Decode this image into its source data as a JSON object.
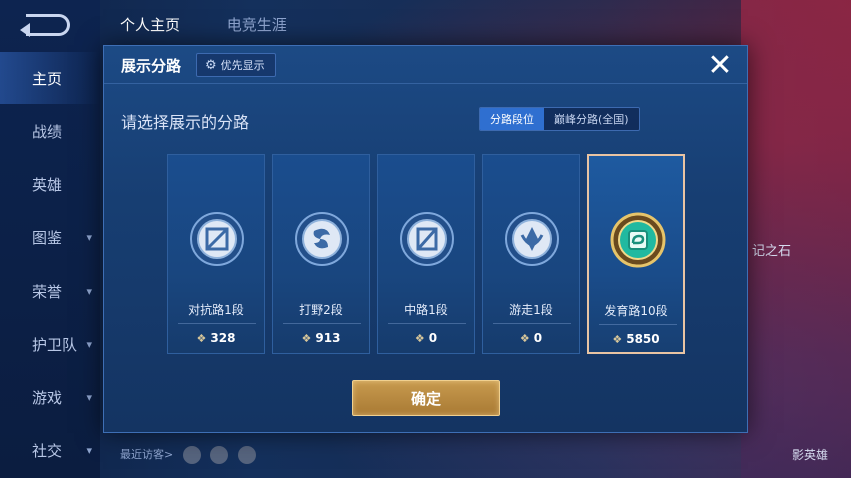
{
  "background": {
    "nav_items": [
      {
        "label": "主页",
        "active": true
      },
      {
        "label": "战绩"
      },
      {
        "label": "英雄"
      },
      {
        "label": "图鉴",
        "has_chevron": true
      },
      {
        "label": "荣誉",
        "has_chevron": true
      },
      {
        "label": "护卫队",
        "has_chevron": true
      },
      {
        "label": "游戏",
        "has_chevron": true
      },
      {
        "label": "社交",
        "has_chevron": true
      }
    ],
    "top_tabs": [
      "个人主页",
      "电竞生涯"
    ],
    "recent_visitors_label": "最近访客>",
    "right_label": "记之石",
    "right_label_bottom": "影英雄"
  },
  "modal": {
    "title": "展示分路",
    "priority_button": "优先显示",
    "close_icon": "close-icon",
    "subtitle": "请选择展示的分路",
    "toggle": {
      "options": [
        "分路段位",
        "巅峰分路(全国)"
      ],
      "selected_index": 0
    },
    "lanes": [
      {
        "name": "对抗路1段",
        "score": "328",
        "emblem": "clash-lane-emblem",
        "selected": false
      },
      {
        "name": "打野2段",
        "score": "913",
        "emblem": "jungle-emblem",
        "selected": false
      },
      {
        "name": "中路1段",
        "score": "0",
        "emblem": "mid-lane-emblem",
        "selected": false
      },
      {
        "name": "游走1段",
        "score": "0",
        "emblem": "roam-emblem",
        "selected": false
      },
      {
        "name": "发育路10段",
        "score": "5850",
        "emblem": "farm-lane-emblem",
        "selected": true
      }
    ],
    "confirm_button": "确定"
  }
}
